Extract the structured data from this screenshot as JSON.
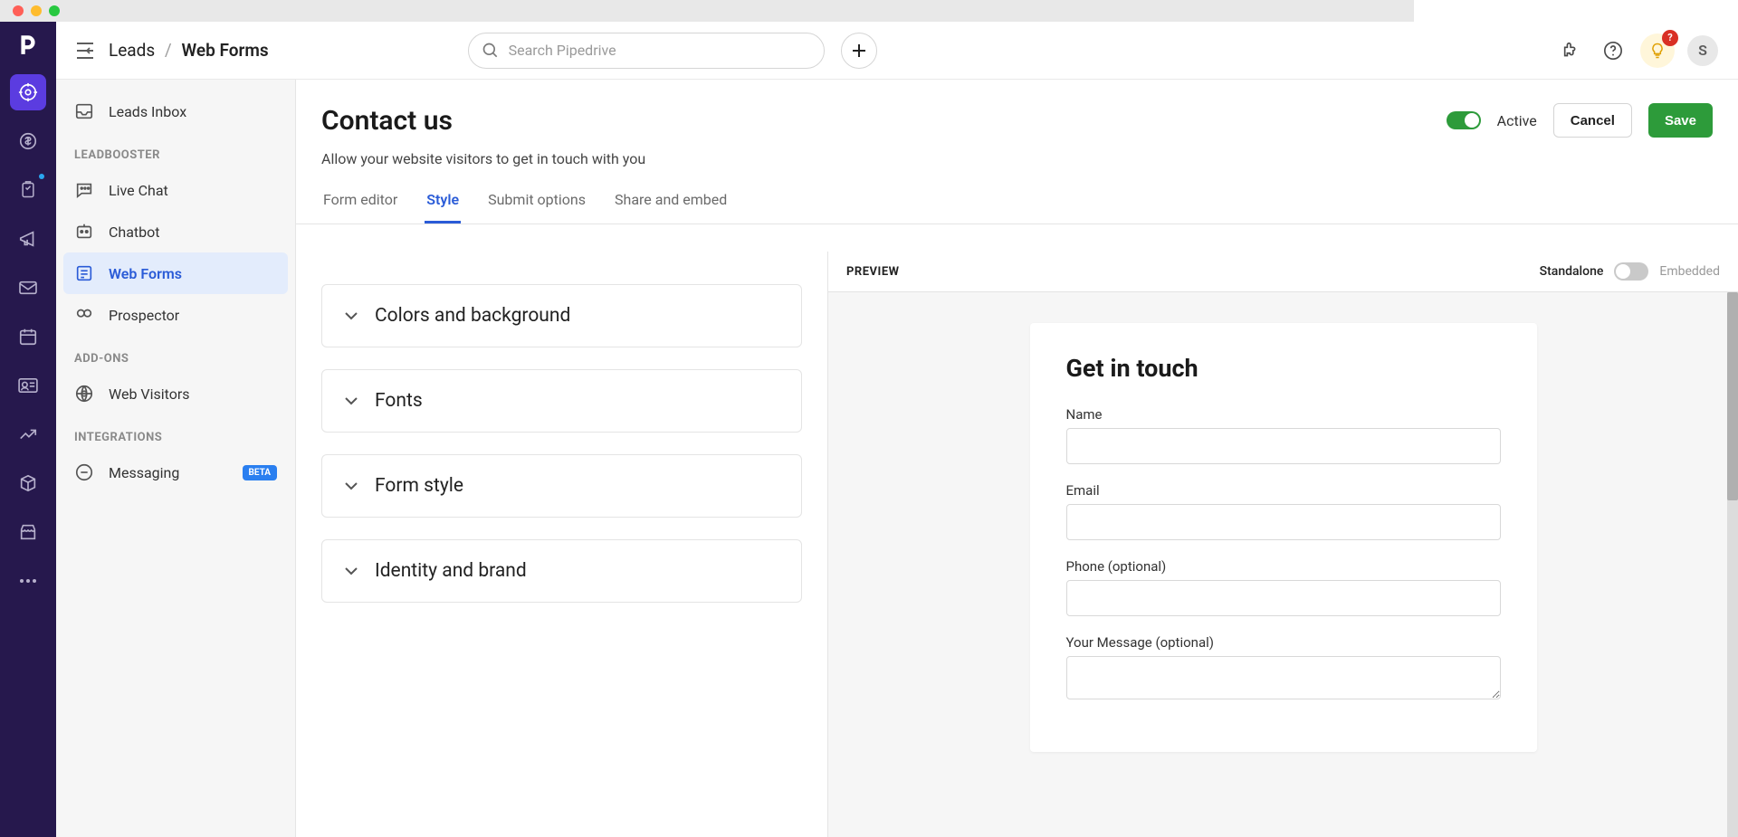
{
  "breadcrumb": {
    "parent": "Leads",
    "current": "Web Forms"
  },
  "search": {
    "placeholder": "Search Pipedrive"
  },
  "notifications": {
    "badge": "?"
  },
  "avatar": {
    "initial": "S"
  },
  "sidebar": {
    "top_item": "Leads Inbox",
    "sections": [
      {
        "heading": "LEADBOOSTER",
        "items": [
          {
            "label": "Live Chat"
          },
          {
            "label": "Chatbot"
          },
          {
            "label": "Web Forms",
            "active": true
          },
          {
            "label": "Prospector"
          }
        ]
      },
      {
        "heading": "ADD-ONS",
        "items": [
          {
            "label": "Web Visitors"
          }
        ]
      },
      {
        "heading": "INTEGRATIONS",
        "items": [
          {
            "label": "Messaging",
            "badge": "BETA"
          }
        ]
      }
    ]
  },
  "page": {
    "title": "Contact us",
    "subtitle": "Allow your website visitors to get in touch with you",
    "active_label": "Active",
    "cancel": "Cancel",
    "save": "Save"
  },
  "tabs": [
    {
      "label": "Form editor"
    },
    {
      "label": "Style",
      "active": true
    },
    {
      "label": "Submit options"
    },
    {
      "label": "Share and embed"
    }
  ],
  "accordion": [
    {
      "title": "Colors and background"
    },
    {
      "title": "Fonts"
    },
    {
      "title": "Form style"
    },
    {
      "title": "Identity and brand"
    }
  ],
  "preview": {
    "label": "PREVIEW",
    "mode_a": "Standalone",
    "mode_b": "Embedded",
    "form_title": "Get in touch",
    "fields": [
      {
        "label": "Name",
        "type": "text"
      },
      {
        "label": "Email",
        "type": "text"
      },
      {
        "label": "Phone (optional)",
        "type": "text"
      },
      {
        "label": "Your Message (optional)",
        "type": "textarea"
      }
    ]
  }
}
